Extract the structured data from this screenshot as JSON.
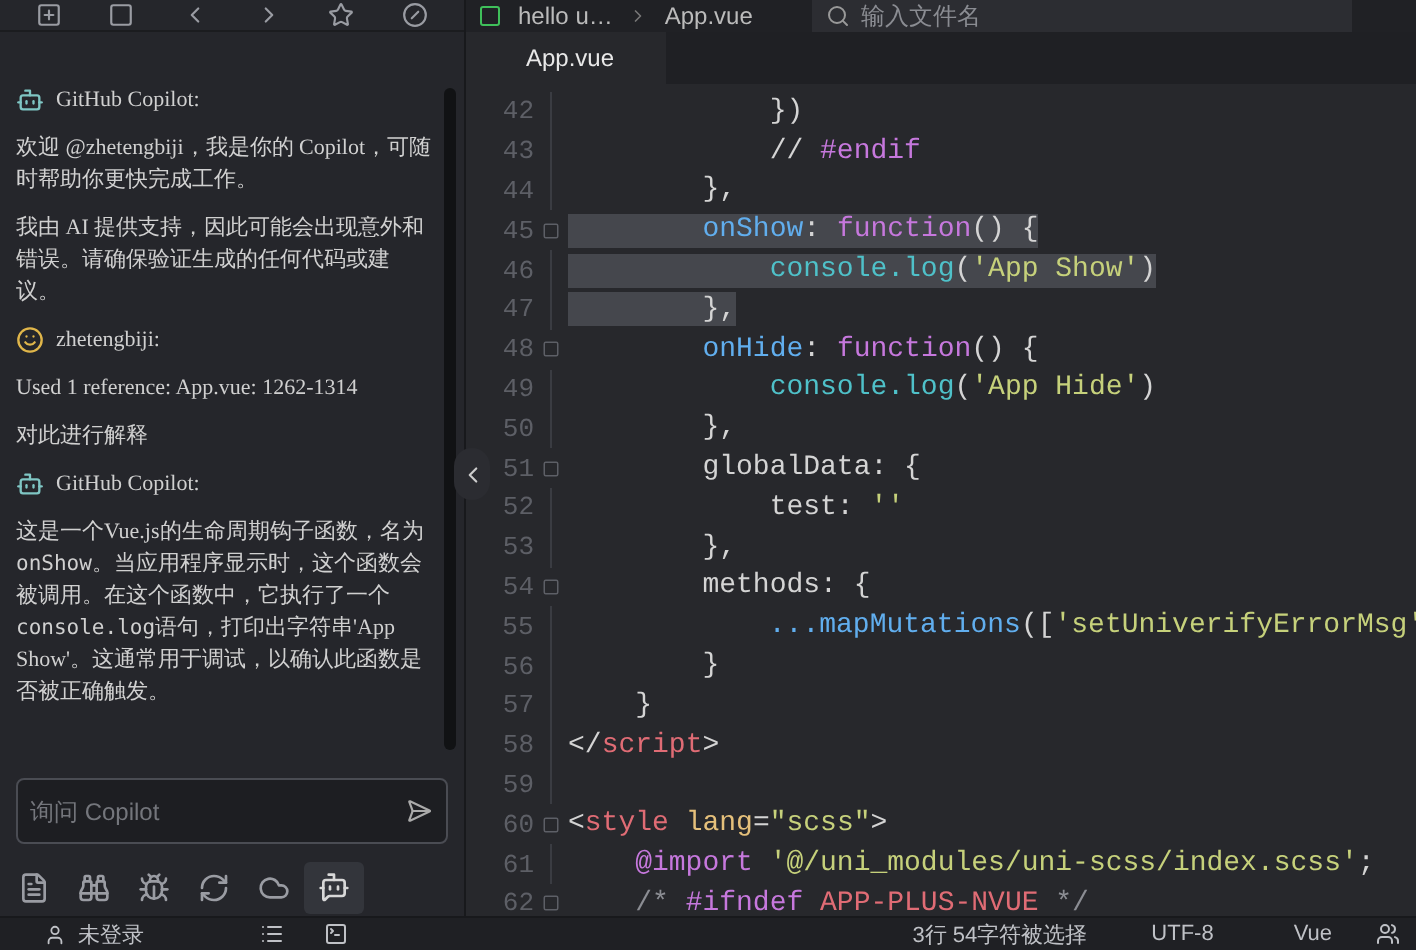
{
  "breadcrumb": {
    "items": [
      "hello u…",
      "App.vue"
    ],
    "search": {
      "placeholder": "输入文件名"
    }
  },
  "chat": {
    "messages": [
      {
        "kind": "bot",
        "author": "GitHub Copilot:",
        "paragraphs": [
          [
            {
              "text": "欢迎 @zhetengbiji，我是你的 Copilot，可随时帮助你更快完成工作。",
              "code": false
            }
          ],
          [
            {
              "text": "我由 AI 提供支持，因此可能会出现意外和错误。请确保验证生成的任何代码或建议。",
              "code": false
            }
          ]
        ]
      },
      {
        "kind": "user",
        "author": "zhetengbiji:",
        "paragraphs": [
          [
            {
              "text": "Used 1 reference: App.vue: 1262-1314",
              "code": false
            }
          ],
          [
            {
              "text": "对此进行解释",
              "code": false
            }
          ]
        ]
      },
      {
        "kind": "bot",
        "author": "GitHub Copilot:",
        "paragraphs": [
          [
            {
              "text": "这是一个Vue.js的生命周期钩子函数，名为",
              "code": false
            },
            {
              "text": "onShow",
              "code": true
            },
            {
              "text": "。当应用程序显示时，这个函数会被调用。在这个函数中，它执行了一个",
              "code": false
            },
            {
              "text": "console.log",
              "code": true
            },
            {
              "text": "语句，打印出字符串'App Show'。这通常用于调试，以确认此函数是否被正确触发。",
              "code": false
            }
          ]
        ]
      }
    ],
    "input": {
      "placeholder": "询问 Copilot"
    }
  },
  "tabs": [
    {
      "label": "App.vue",
      "selected": true
    }
  ],
  "bottom_tools": [
    {
      "kind": "files",
      "selected": false
    },
    {
      "kind": "binoculars",
      "selected": false
    },
    {
      "kind": "bug",
      "selected": false
    },
    {
      "kind": "refresh",
      "selected": false
    },
    {
      "kind": "cloud",
      "selected": false
    },
    {
      "kind": "copilot",
      "selected": true
    }
  ],
  "code": {
    "lines": [
      {
        "number": "42",
        "fold": false,
        "selected": false,
        "tokens": [
          {
            "kind": "plain",
            "text": "            })"
          }
        ]
      },
      {
        "number": "43",
        "fold": false,
        "selected": false,
        "tokens": [
          {
            "kind": "plain",
            "text": "            // "
          },
          {
            "kind": "directive",
            "text": "#endif"
          }
        ]
      },
      {
        "number": "44",
        "fold": false,
        "selected": false,
        "tokens": [
          {
            "kind": "plain",
            "text": "        },"
          }
        ]
      },
      {
        "number": "45",
        "fold": true,
        "selected": true,
        "tokens": [
          {
            "kind": "prop",
            "text": "        onShow"
          },
          {
            "kind": "plain",
            "text": ": "
          },
          {
            "kind": "keyword",
            "text": "function"
          },
          {
            "kind": "plain",
            "text": "() {"
          }
        ]
      },
      {
        "number": "46",
        "fold": false,
        "selected": true,
        "tokens": [
          {
            "kind": "object",
            "text": "            console.log"
          },
          {
            "kind": "plain",
            "text": "("
          },
          {
            "kind": "string",
            "text": "'App Show'"
          },
          {
            "kind": "plain",
            "text": ")"
          }
        ]
      },
      {
        "number": "47",
        "fold": false,
        "selected": true,
        "tokens": [
          {
            "kind": "plain",
            "text": "        },"
          }
        ]
      },
      {
        "number": "48",
        "fold": true,
        "selected": false,
        "tokens": [
          {
            "kind": "prop",
            "text": "        onHide"
          },
          {
            "kind": "plain",
            "text": ": "
          },
          {
            "kind": "keyword",
            "text": "function"
          },
          {
            "kind": "plain",
            "text": "() {"
          }
        ]
      },
      {
        "number": "49",
        "fold": false,
        "selected": false,
        "tokens": [
          {
            "kind": "object",
            "text": "            console.log"
          },
          {
            "kind": "plain",
            "text": "("
          },
          {
            "kind": "string",
            "text": "'App Hide'"
          },
          {
            "kind": "plain",
            "text": ")"
          }
        ]
      },
      {
        "number": "50",
        "fold": false,
        "selected": false,
        "tokens": [
          {
            "kind": "plain",
            "text": "        },"
          }
        ]
      },
      {
        "number": "51",
        "fold": true,
        "selected": false,
        "tokens": [
          {
            "kind": "plain",
            "text": "        globalData: {"
          }
        ]
      },
      {
        "number": "52",
        "fold": false,
        "selected": false,
        "tokens": [
          {
            "kind": "plain",
            "text": "            test: "
          },
          {
            "kind": "string",
            "text": "''"
          }
        ]
      },
      {
        "number": "53",
        "fold": false,
        "selected": false,
        "tokens": [
          {
            "kind": "plain",
            "text": "        },"
          }
        ]
      },
      {
        "number": "54",
        "fold": true,
        "selected": false,
        "tokens": [
          {
            "kind": "plain",
            "text": "        methods: {"
          }
        ]
      },
      {
        "number": "55",
        "fold": false,
        "selected": false,
        "tokens": [
          {
            "kind": "prop",
            "text": "            ...mapMutations"
          },
          {
            "kind": "plain",
            "text": "(["
          },
          {
            "kind": "string",
            "text": "'setUniverifyErrorMsg'"
          }
        ]
      },
      {
        "number": "56",
        "fold": false,
        "selected": false,
        "tokens": [
          {
            "kind": "plain",
            "text": "        }"
          }
        ]
      },
      {
        "number": "57",
        "fold": false,
        "selected": false,
        "tokens": [
          {
            "kind": "plain",
            "text": "    }"
          }
        ]
      },
      {
        "number": "58",
        "fold": false,
        "selected": false,
        "tokens": [
          {
            "kind": "plain",
            "text": "</"
          },
          {
            "kind": "tag",
            "text": "script"
          },
          {
            "kind": "plain",
            "text": ">"
          }
        ]
      },
      {
        "number": "59",
        "fold": false,
        "selected": false
      },
      {
        "number": "60",
        "fold": true,
        "selected": false,
        "tokens": [
          {
            "kind": "plain",
            "text": "<"
          },
          {
            "kind": "tag",
            "text": "style"
          },
          {
            "kind": "attr",
            "text": " lang"
          },
          {
            "kind": "plain",
            "text": "="
          },
          {
            "kind": "string",
            "text": "\"scss\""
          },
          {
            "kind": "plain",
            "text": ">"
          }
        ]
      },
      {
        "number": "61",
        "fold": false,
        "selected": false,
        "tokens": [
          {
            "kind": "directive",
            "text": "    @import"
          },
          {
            "kind": "string",
            "text": " '@/uni_modules/uni-scss/index.scss'"
          },
          {
            "kind": "plain",
            "text": ";"
          }
        ]
      },
      {
        "number": "62",
        "fold": true,
        "selected": false,
        "tokens": [
          {
            "kind": "comment",
            "text": "    /* "
          },
          {
            "kind": "directive",
            "text": "#ifndef"
          },
          {
            "kind": "tag",
            "text": " APP-PLUS-NVUE"
          },
          {
            "kind": "comment",
            "text": " */"
          }
        ]
      }
    ]
  },
  "status_bar": {
    "login": "未登录",
    "selection": "3行 54字符被选择",
    "encoding": "UTF-8",
    "language": "Vue"
  }
}
